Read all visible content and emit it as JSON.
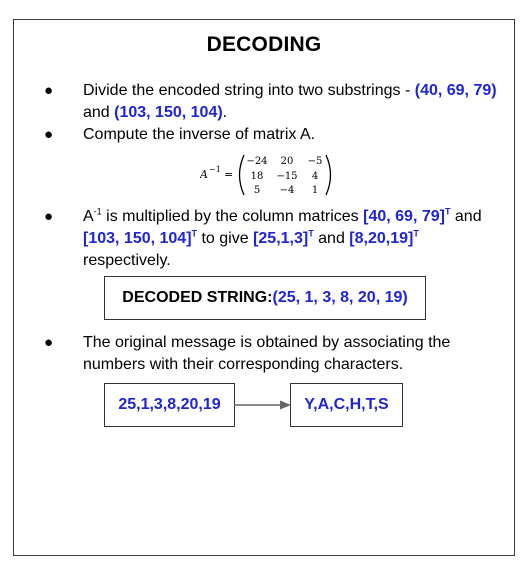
{
  "title": "DECODING",
  "bullet_glyph": "●",
  "item1": {
    "text_a": "Divide the encoded string into two substrings - ",
    "sub1": "(40, 69, 79)",
    "text_b": "and ",
    "sub2": "(103, 150, 104)",
    "text_c": "."
  },
  "item2": {
    "text": "Compute the inverse of matrix A."
  },
  "matrix": {
    "lhs_base": "A",
    "lhs_exp": "−1",
    "equals": "=",
    "rows": [
      [
        "−24",
        "20",
        "−5"
      ],
      [
        "18",
        "−15",
        "4"
      ],
      [
        "5",
        "−4",
        "1"
      ]
    ]
  },
  "item3": {
    "a": "A",
    "a_sup": "-1",
    "text1": " is multiplied by the column matrices ",
    "m1": "[40, 69, 79]",
    "m1_sup": "T",
    "and1": " and",
    "m2": "[103, 150, 104]",
    "m2_sup": "T",
    "text2": " to give ",
    "r1": "[25,1,3]",
    "r1_sup": "T",
    "and2": " and ",
    "r2": "[8,20,19]",
    "r2_sup": "T",
    "text3": "respectively."
  },
  "decoded": {
    "label": "DECODED STRING: ",
    "value": "(25, 1, 3, 8, 20, 19)"
  },
  "item4": {
    "text": "The original message is obtained by associating the numbers with their corresponding characters."
  },
  "flow": {
    "from": "25,1,3,8,20,19",
    "to": "Y,A,C,H,T,S"
  }
}
